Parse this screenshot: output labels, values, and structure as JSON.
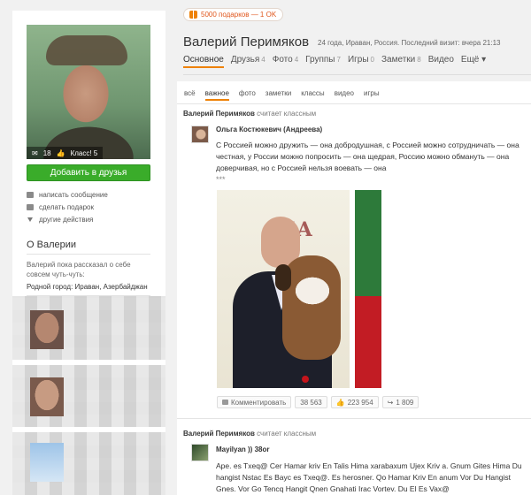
{
  "promo": {
    "label": "5000 подарков — 1 OK"
  },
  "profile": {
    "name": "Валерий Перимяков",
    "meta": "24 года, Ираван, Россия. Последний визит: вчера 21:13",
    "stats": {
      "comments": "18",
      "class_label": "Класс! 5"
    },
    "add_friend": "Добавить в друзья",
    "actions": [
      "написать сообщение",
      "сделать подарок",
      "другие действия"
    ],
    "about_title": "О Валерии",
    "about_text": "Валерий пока рассказал о себе совсем чуть-чуть:",
    "about_city": "Родной город: Ираван, Азербайджан"
  },
  "nav": {
    "tabs": [
      {
        "label": "Основное",
        "count": ""
      },
      {
        "label": "Друзья",
        "count": "4"
      },
      {
        "label": "Фото",
        "count": "4"
      },
      {
        "label": "Группы",
        "count": "7"
      },
      {
        "label": "Игры",
        "count": "0"
      },
      {
        "label": "Заметки",
        "count": "8"
      },
      {
        "label": "Видео",
        "count": ""
      },
      {
        "label": "Ещё ▾",
        "count": ""
      }
    ]
  },
  "subtabs": [
    "всё",
    "важное",
    "фото",
    "заметки",
    "классы",
    "видео",
    "игры"
  ],
  "feed": {
    "item1": {
      "head_name": "Валерий Перимяков",
      "head_action": "считает классным",
      "author": "Ольга Костюкевич (Андреева)",
      "text": "С Россией можно дружить — она добродушная, с Россией можно сотрудничать — она честная, у России можно попросить — она щедрая, Россию можно обмануть — она доверчивая, но с Россией нельзя воевать — она",
      "stars": "***",
      "photo_sign": "RIA",
      "comment_label": "Комментировать",
      "comments": "38 563",
      "likes": "223 954",
      "shares": "1 809"
    },
    "item2": {
      "head_name": "Валерий Перимяков",
      "head_action": "считает классным",
      "author": "Mayilyan )) 38or",
      "text": "Ape. es Txeq@ Cer Hamar kriv En Talis Hima xarabaxum Ujex Kriv a. Gnum Gites Hima Du hangist Nstac Es Bayc es Txeq@. Es herosner. Qo Hamar Kriv En anum Vor Du Hangist Gnes. Vor Go Tencq Hangit Qnen Gnahati Irac  Vortev. Du El Es Vax@"
    }
  },
  "colors": {
    "accent": "#ee8208",
    "green_button": "#3aac2a",
    "promo_text": "#e0561c"
  }
}
